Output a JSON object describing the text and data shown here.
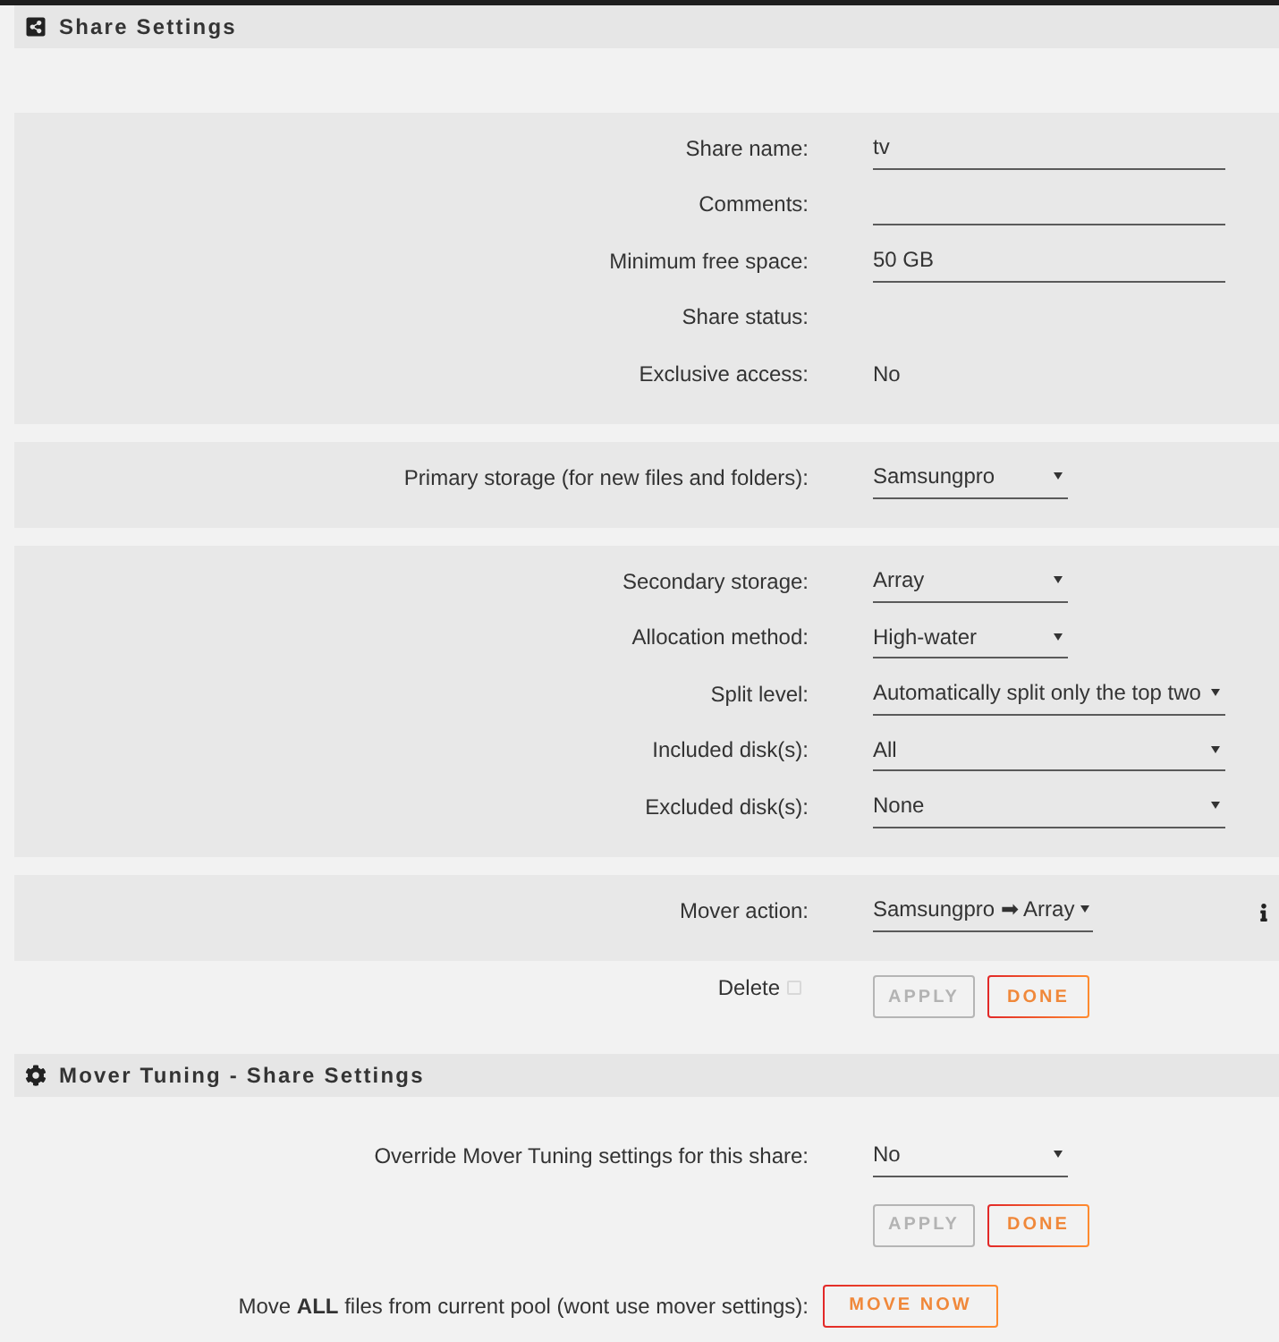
{
  "share_settings": {
    "title": "Share Settings",
    "panels": [
      {
        "rows": [
          {
            "kind": "input",
            "label": "Share name:",
            "value": "tv"
          },
          {
            "kind": "input",
            "label": "Comments:"
          },
          {
            "kind": "input",
            "label": "Minimum free space:",
            "value": "50 GB"
          },
          {
            "kind": "text",
            "label": "Share status:"
          },
          {
            "kind": "text",
            "label": "Exclusive access:",
            "value": "No"
          }
        ]
      },
      {
        "rows": [
          {
            "kind": "select",
            "label": "Primary storage (for new files and folders):",
            "value": "Samsungpro"
          }
        ]
      },
      {
        "rows": [
          {
            "kind": "select",
            "label": "Secondary storage:",
            "value": "Array"
          },
          {
            "kind": "select",
            "label": "Allocation method:",
            "value": "High-water"
          },
          {
            "kind": "select",
            "label": "Split level:",
            "value": "Automatically split only the top two"
          },
          {
            "kind": "select",
            "label": "Included disk(s):",
            "value": "All"
          },
          {
            "kind": "select",
            "label": "Excluded disk(s):",
            "value": "None"
          }
        ]
      },
      {
        "rows": [
          {
            "kind": "select",
            "label": "Mover action:",
            "value": "Samsungpro ➡ Array"
          }
        ]
      }
    ],
    "delete": {
      "label": "Delete",
      "checked": false
    },
    "buttons": [
      {
        "label": "APPLY",
        "disabled": true
      },
      {
        "label": "DONE",
        "disabled": false
      }
    ]
  },
  "mover_tuning": {
    "title": "Mover Tuning - Share Settings",
    "rows": [
      {
        "kind": "select",
        "label": "Override Mover Tuning settings for this share:",
        "value": "No"
      }
    ],
    "buttons": [
      {
        "label": "APPLY",
        "disabled": true
      },
      {
        "label": "DONE",
        "disabled": false
      }
    ],
    "move_all": {
      "label": "Move **ALL** files from current pool (wont use mover settings):",
      "button": "MOVE NOW"
    }
  }
}
